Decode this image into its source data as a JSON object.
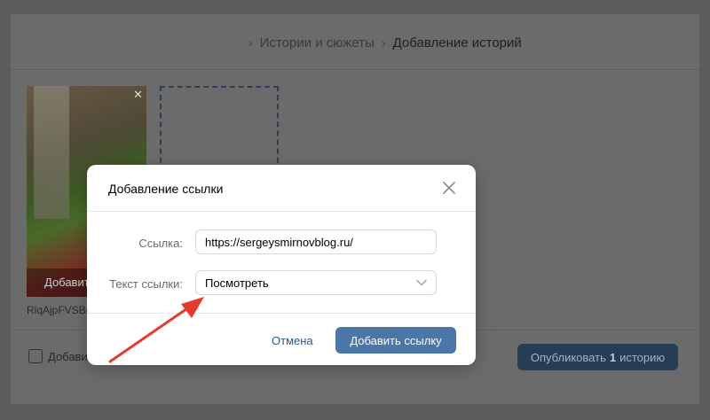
{
  "breadcrumbs": {
    "item1": "Истории и сюжеты",
    "current": "Добавление историй"
  },
  "story_card": {
    "overlay_label": "Добавит",
    "filename": "RlqAjpFVSBg"
  },
  "footer": {
    "checkbox_label": "Добави",
    "publish_prefix": "Опубликовать",
    "publish_count": "1",
    "publish_suffix": "историю"
  },
  "modal": {
    "title": "Добавление ссылки",
    "link_label": "Ссылка:",
    "link_value": "https://sergeysmirnovblog.ru/",
    "text_label": "Текст ссылки:",
    "text_value": "Посмотреть",
    "cancel_label": "Отмена",
    "submit_label": "Добавить ссылку"
  },
  "colors": {
    "accent": "#4a76a8",
    "link": "#2a5885",
    "annotation_arrow": "#e53b2c"
  },
  "icons": {
    "close": "close-icon",
    "chevron": "chevron-down-icon",
    "arrow": "annotation-arrow"
  }
}
